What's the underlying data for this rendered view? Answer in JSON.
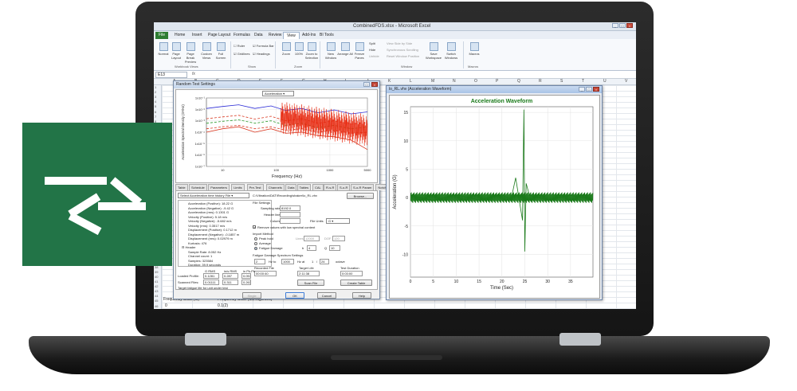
{
  "excel": {
    "window_title": "CombinedFDS.xlsx - Microsoft Excel",
    "tabs": [
      "File",
      "Home",
      "Insert",
      "Page Layout",
      "Formulas",
      "Data",
      "Review",
      "View",
      "Add-Ins",
      "BI Tools"
    ],
    "active_tab": "View",
    "ribbon": {
      "buttons": [
        "Normal",
        "Page Layout",
        "Page Break Preview",
        "Custom Views",
        "Full Screen",
        "Zoom",
        "100%",
        "Zoom to Selection",
        "New Window",
        "Arrange All",
        "Freeze Panes",
        "Save Workspace",
        "Switch Windows",
        "Macros"
      ],
      "checkboxes": [
        "Ruler",
        "Formula Bar",
        "Gridlines",
        "Headings"
      ],
      "window_options": [
        "Split",
        "Hide",
        "Unhide",
        "View Side by Side",
        "Synchronous Scrolling",
        "Reset Window Position"
      ],
      "groups": [
        "Workbook Views",
        "Show",
        "Zoom",
        "Window",
        "Macros"
      ]
    },
    "name_box": "E13",
    "columns": [
      "A",
      "B",
      "C",
      "D",
      "E",
      "F",
      "G",
      "H",
      "I",
      "J",
      "K",
      "L",
      "M",
      "N",
      "O",
      "P",
      "Q",
      "R",
      "S",
      "T",
      "U",
      "V"
    ],
    "rows": [
      "1",
      "2",
      "3",
      "4",
      "5",
      "6",
      "7",
      "8",
      "9",
      "10",
      "11",
      "12",
      "13",
      "14",
      "15",
      "16",
      "17",
      "18",
      "19",
      "20",
      "21",
      "22",
      "23",
      "24",
      "25",
      "26",
      "27",
      "28",
      "29",
      "30",
      "31",
      "32",
      "33",
      "34",
      "35",
      "36",
      "37",
      "38",
      "39",
      "40",
      "41",
      "42",
      "43",
      "44",
      "45",
      "46"
    ],
    "cells": {
      "row45_a": "Frequency Scan (G)",
      "row45_b": "Frequency Scan (damage/sec)",
      "row46_a": "0",
      "row46_b": "0.1(2)"
    }
  },
  "dialog": {
    "title": "Random Test Settings",
    "series_select": "Acceleration",
    "plot": {
      "ylabel": "Acceleration Spectral Density (G²/Hz)",
      "xlabel": "Frequency (Hz)",
      "yticks": [
        "1x10⁻¹",
        "1x10⁻²",
        "1x10⁻³",
        "1x10⁻⁴",
        "1x10⁻⁵",
        "1x10⁻⁶",
        "1x10⁻⁷"
      ],
      "xticks": [
        "10",
        "100",
        "1000",
        "5000"
      ]
    },
    "tabs": [
      "Table",
      "Schedule",
      "Parameters",
      "Limits",
      "Pre-Test",
      "Channels",
      "Data",
      "Tables",
      "CAL",
      "R-s-R",
      "S-o-R",
      "S-o-R Param",
      "Notch",
      "Import"
    ],
    "active_tab": "Import",
    "import": {
      "source_select": "Select Acceleration time history File",
      "file_path": "C:\\Vibration\\DAT\\Recording\\shaker\\lo_RL.vhv",
      "browse": "Browse...",
      "tree": [
        "Acceleration (Positive): 18.22 G",
        "Acceleration (Negative): -9.42 G",
        "Acceleration (rms): 0.1301 G",
        "Velocity (Positive): 5.18 m/s",
        "Velocity (Negative): -5.682 m/s",
        "Velocity (rms): 0.3517 m/s",
        "Displacement (Positive): 0.1712 m",
        "Displacement (Negative): -0.1857 m",
        "Displacement (rms): 0.02979 m",
        "Kurtosis: 476",
        "Header",
        "Sample Rate: 8.052 Hz",
        "Channel count: 1",
        "Samples: 323584",
        "Duration: 39.9 seconds"
      ],
      "file_settings": {
        "title": "File Settings",
        "sampling_rate_label": "Sampling rate:",
        "sampling_rate": "8192.0",
        "header_lines_label": "Header lines",
        "column_label": "Column",
        "file_units_label": "File Units",
        "file_units": "G",
        "remove_values": "Remove values with low spectral content"
      },
      "import_method": {
        "title": "Import Method",
        "options": [
          "Peak hold",
          "Average",
          "Fatigue Damage"
        ],
        "selected": "Fatigue Damage",
        "lines_label": "Lines",
        "lines_value": "12000",
        "dof_label": "DOF",
        "dof_value": "120",
        "b_label": "b",
        "b_value": "4",
        "q_label": "Q",
        "q_value": "10"
      },
      "fds": {
        "title": "Fatigue Damage Spectrum Settings",
        "start_hz": "2",
        "hz_to": "Hz to",
        "end_hz": "1000",
        "hz_at": "Hz at",
        "octave_num": "1",
        "octave_den": "24",
        "octave_label": "octave",
        "recorded_file_label": "Recorded File",
        "recorded_file": "00:00:40",
        "target_life_label": "Target Life",
        "target_life": "2:11:38",
        "test_duration_label": "Test Duration",
        "test_duration": "0:03:00"
      },
      "summary": {
        "headers": [
          "G RMS",
          "in/s RMS",
          "in Pk-Pk"
        ],
        "loaded_label": "Loaded Profile:",
        "loaded": [
          "0.1281",
          "0.287",
          "0.05766"
        ],
        "scanned_label": "Scanned Files:",
        "scanned": [
          "0.01111",
          "0.311",
          "0.2631"
        ],
        "note": "Target fatigue life for unit under test"
      },
      "scan_file": "Scan File",
      "create_table": "Create Table",
      "single": "Single"
    },
    "ok": "OK",
    "cancel": "Cancel",
    "help": "Help"
  },
  "wave": {
    "window_title": "lo_RL.vhv (Acceleration Waveform)",
    "chart_title": "Acceleration Waveform",
    "ylabel": "Acceleration (G)",
    "xlabel": "Time (Sec)",
    "yticks": [
      "15",
      "10",
      "5",
      "0",
      "-5",
      "-10"
    ],
    "xticks": [
      "0",
      "5",
      "10",
      "15",
      "20",
      "25",
      "30",
      "35"
    ]
  },
  "colors": {
    "brand_green": "#227447",
    "wave_green": "#1a7a1a",
    "plot_blue": "#2b2bd6",
    "plot_red": "#e8280e"
  },
  "chart_data": [
    {
      "type": "line",
      "title": "Acceleration Waveform",
      "xlabel": "Time (Sec)",
      "ylabel": "Acceleration (G)",
      "xlim": [
        0,
        39.9
      ],
      "ylim": [
        -14,
        16
      ],
      "series": [
        {
          "x": [
            0,
            5,
            10,
            15,
            20,
            22,
            23,
            24.5,
            24.8,
            25.0,
            25.3,
            26,
            30,
            35,
            39.9
          ],
          "y": [
            0.4,
            -0.5,
            0.5,
            -0.4,
            0.5,
            -0.3,
            3.5,
            -4.0,
            15.5,
            -9.5,
            2.5,
            0.4,
            -0.4,
            0.4,
            -0.3
          ]
        }
      ]
    },
    {
      "type": "line",
      "ylabel": "Acceleration Spectral Density (G²/Hz)",
      "xlabel": "Frequency (Hz)",
      "xscale": "log",
      "yscale": "log",
      "xlim": [
        5,
        5000
      ],
      "ylim": [
        1e-07,
        0.1
      ],
      "series": [
        {
          "x": [
            5,
            10,
            20,
            40,
            80,
            150,
            300,
            600,
            1200,
            2500,
            5000
          ],
          "y": [
            0.012,
            0.018,
            0.025,
            0.012,
            0.02,
            0.008,
            0.012,
            0.005,
            0.009,
            0.004,
            0.006
          ]
        },
        {
          "x": [
            5,
            10,
            20,
            40,
            80,
            150,
            300,
            600,
            1200,
            2500,
            5000
          ],
          "y": [
            0.0015,
            0.0022,
            0.003,
            0.0014,
            0.0025,
            0.001,
            0.0015,
            0.0006,
            0.001,
            0.0005,
            0.0007
          ]
        },
        {
          "x": [
            5,
            10,
            20,
            40,
            80,
            150,
            300,
            600,
            1200,
            2500,
            5000
          ],
          "y": [
            0.0006,
            0.0009,
            0.0012,
            0.0006,
            0.001,
            0.0004,
            0.0006,
            0.00025,
            0.0004,
            0.0002,
            0.0003
          ]
        },
        {
          "x": [
            5,
            10,
            20,
            40,
            80,
            150,
            300,
            600,
            1200,
            2500,
            5000
          ],
          "y": [
            0.0002,
            0.0003,
            0.0004,
            0.0002,
            0.0003,
            0.00015,
            0.0002,
            0.0001,
            0.00015,
            8e-05,
            0.0001
          ]
        },
        {
          "x": [
            5,
            10,
            20,
            40,
            80,
            150,
            300,
            600,
            1200,
            2500,
            5000
          ],
          "y": [
            0.0001,
            0.0002,
            0.0003,
            0.0001,
            0.0002,
            8e-05,
            0.0001,
            5e-05,
            4e-05,
            2e-05,
            3e-06
          ]
        }
      ]
    }
  ]
}
